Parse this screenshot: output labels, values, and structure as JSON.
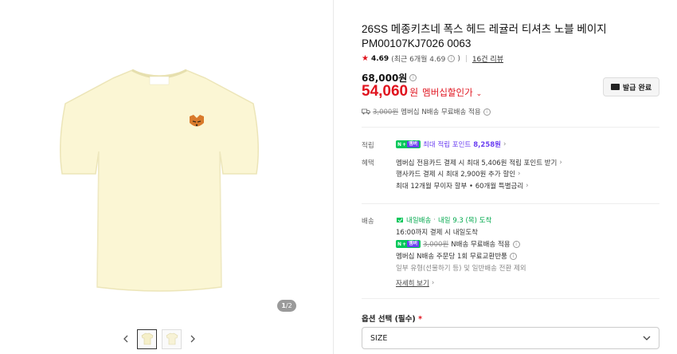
{
  "gallery": {
    "pager_current": "1",
    "pager_total": "/2",
    "thumb_count": 2
  },
  "product": {
    "title_line1": "26SS 메종키츠네 폭스 헤드 레귤러 티셔츠 노블 베이지",
    "title_line2": "PM00107KJ7026 0063",
    "rating_score": "4.69",
    "rating_recent": "(최근 6개월 4.69",
    "review_count": "16건 리뷰",
    "original_price": "68,000원",
    "sale_price": "54,060",
    "sale_currency": "원",
    "member_price_label": "멤버십할인가",
    "shipping_strike": "3,000원",
    "shipping_text": "멤버십 N배송 무료배송 적용",
    "coupon_button": "발급 완료"
  },
  "benefits": {
    "earn_label": "적립",
    "earn_badge_n": "N",
    "earn_badge_member": "멤버",
    "earn_text": "최대 적립 포인트",
    "earn_points": "8,258원",
    "perk_label": "혜택",
    "perk_line1": "멤버십 전용카드 결제 시 최대 5,406원 적립 포인트 받기",
    "perk_line2": "행사카드 결제 시 최대 2,900원 추가 할인",
    "perk_line3": "최대 12개월 무이자 할부 • 60개월 특별금리"
  },
  "delivery": {
    "label": "배송",
    "fast_badge": "내일배송",
    "eta": "내일 9.3 (목) 도착",
    "cutoff": "16:00까지 결제 시 내일도착",
    "free_strike": "3,000원",
    "free_text": "N배송 무료배송 적용",
    "exchange": "멤버십 N배송 주문당 1회 무료교환반품",
    "exclusion": "일부 유형(선물하기 등) 및 일반배송 전환 제외",
    "details_link": "자세히 보기"
  },
  "options": {
    "label": "옵션 선택 (필수)",
    "required_mark": "*",
    "select_value": "SIZE"
  },
  "colors": {
    "sale_red": "#e0131e",
    "naver_green": "#03c75a",
    "member_purple": "#6b3ff2",
    "shirt": "#fbf6d4"
  }
}
